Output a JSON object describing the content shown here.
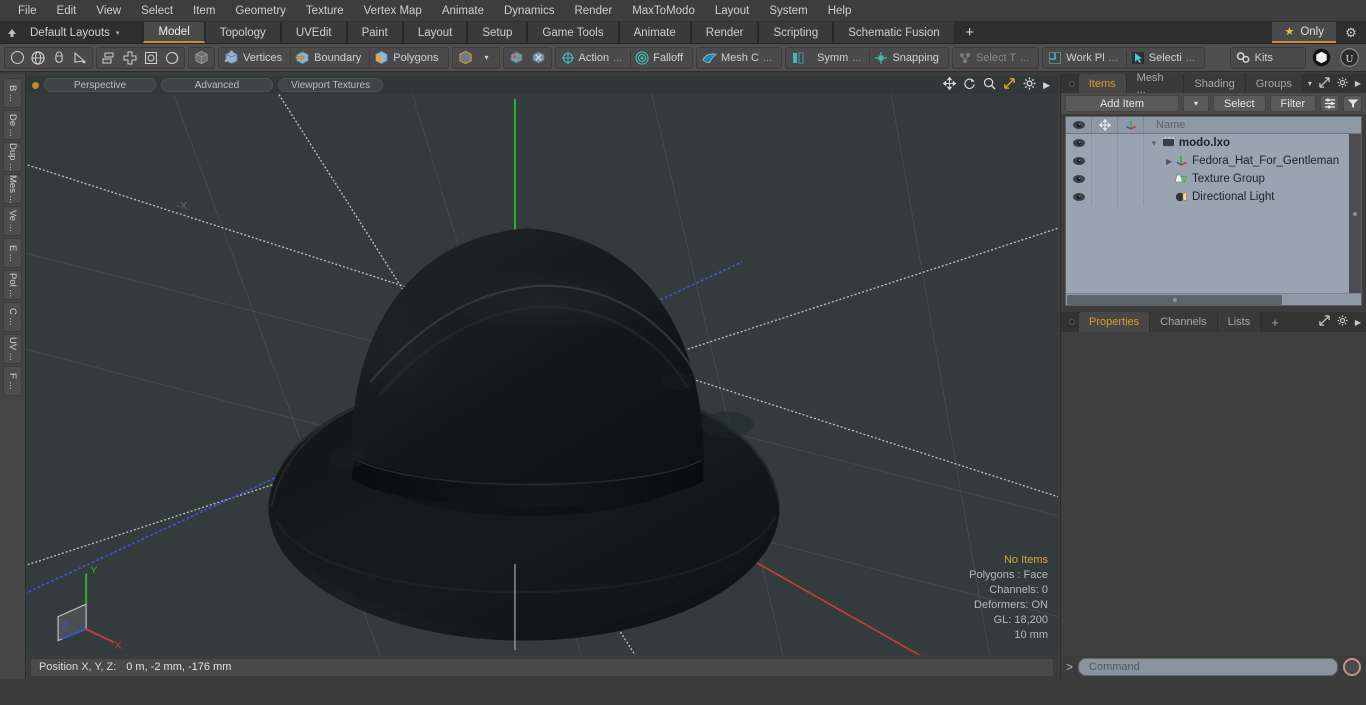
{
  "menu": {
    "items": [
      "File",
      "Edit",
      "View",
      "Select",
      "Item",
      "Geometry",
      "Texture",
      "Vertex Map",
      "Animate",
      "Dynamics",
      "Render",
      "MaxToModo",
      "Layout",
      "System",
      "Help"
    ]
  },
  "layoutbar": {
    "home_icon": "home-icon",
    "layouts_label": "Default Layouts",
    "caret": "▾",
    "tabs": [
      "Model",
      "Topology",
      "UVEdit",
      "Paint",
      "Layout",
      "Setup",
      "Game Tools",
      "Animate",
      "Render",
      "Scripting",
      "Schematic Fusion"
    ],
    "active_tab": "Model",
    "add_tab": "+",
    "only_label": "Only",
    "only_star": "★",
    "gear": "⚙"
  },
  "toolbar": {
    "group1": [
      {
        "name": "circle-tool-icon",
        "glyph": "◯"
      },
      {
        "name": "globe-tool-icon",
        "glyph": "⊕"
      },
      {
        "name": "cone-tool-icon",
        "glyph": "⬯"
      },
      {
        "name": "pen-tool-icon",
        "glyph": "◣"
      }
    ],
    "group2": [
      {
        "name": "align-tool-icon",
        "glyph": "▤"
      },
      {
        "name": "center-tool-icon",
        "glyph": "✛"
      },
      {
        "name": "bounds-tool-icon",
        "glyph": "▣"
      },
      {
        "name": "radial-tool-icon",
        "glyph": "◍"
      }
    ],
    "group3": [
      {
        "name": "items-mode-icon",
        "glyph": "▣",
        "label": ""
      }
    ],
    "selection_modes": [
      {
        "name": "vertices-mode",
        "label": "Vertices"
      },
      {
        "name": "boundary-mode",
        "label": "Boundary"
      },
      {
        "name": "polygons-mode",
        "label": "Polygons"
      }
    ],
    "mesh_dropdown": {
      "name": "mesh-item-dropdown",
      "glyph": "▾"
    },
    "snap_icons": [
      {
        "name": "center-pivot-icon"
      },
      {
        "name": "world-pivot-icon"
      }
    ],
    "action_center": {
      "label": "Action",
      "ellipsis": "..."
    },
    "falloff": {
      "label": "Falloff"
    },
    "mesh_constraint": {
      "label": "Mesh C",
      "ellipsis": "..."
    },
    "symmetry": {
      "label": "Symm",
      "ellipsis": "..."
    },
    "snapping": {
      "label": "Snapping"
    },
    "select_through": {
      "label": "Select T",
      "ellipsis": "...",
      "disabled": true
    },
    "work_plane": {
      "label": "Work Pl",
      "ellipsis": "..."
    },
    "selection_sets": {
      "label": "Selecti",
      "ellipsis": "..."
    },
    "kits": {
      "label": "Kits"
    },
    "app_icons": [
      {
        "name": "modo-logo-icon"
      },
      {
        "name": "unreal-logo-icon"
      }
    ]
  },
  "leftstrip": {
    "buttons": [
      "B ...",
      "De ...",
      "Dup ...",
      "Mes ...",
      "Ve ...",
      "E ...",
      "Pol ...",
      "C ...",
      "UV ...",
      "F ..."
    ]
  },
  "viewport": {
    "header": {
      "dot": "viewport-indicator",
      "chips": [
        "Perspective",
        "Advanced",
        "Viewport Textures"
      ],
      "tools": [
        {
          "name": "pan-icon",
          "glyph": "✥"
        },
        {
          "name": "rotate-icon",
          "glyph": "↻"
        },
        {
          "name": "zoom-icon",
          "glyph": "⌕"
        },
        {
          "name": "fit-icon",
          "glyph": "⤢"
        },
        {
          "name": "gear-icon",
          "glyph": "⚙"
        },
        {
          "name": "expand-arrow-icon",
          "glyph": "▶"
        }
      ]
    },
    "background_color": "#343b3d",
    "axis_labels": {
      "x": "X",
      "y": "Y",
      "z": "Z",
      "neg_x": "-X"
    },
    "axis_colors": {
      "x": "#c44040",
      "y": "#3fb23f",
      "z": "#4050c8",
      "grid": "#4a5254",
      "grid_major": "#c7cdce"
    },
    "model": {
      "name": "fedora-hat-model",
      "color": "#16191a"
    },
    "stats": [
      {
        "text": "No Items",
        "highlight": true
      },
      {
        "text": "Polygons : Face",
        "highlight": false
      },
      {
        "text": "Channels: 0",
        "highlight": false
      },
      {
        "text": "Deformers: ON",
        "highlight": false
      },
      {
        "text": "GL: 18,200",
        "highlight": false
      },
      {
        "text": "10 mm",
        "highlight": false
      }
    ]
  },
  "statusbar": {
    "label": "Position X, Y, Z:",
    "value": "0 m, -2 mm, -176 mm"
  },
  "rightpanel": {
    "toptabs": {
      "items": [
        "Items",
        "Mesh ...",
        "Shading",
        "Groups"
      ],
      "active": "Items",
      "overflow": "▾",
      "tools": [
        {
          "name": "popout-icon",
          "glyph": "⤢"
        },
        {
          "name": "gear-icon",
          "glyph": "⚙"
        },
        {
          "name": "expand-arrow-icon",
          "glyph": "▶"
        }
      ]
    },
    "actionbar": {
      "add_item": "Add Item",
      "add_item_caret": "▾",
      "select": "Select",
      "filter": "Filter",
      "list_icon": "list-options-icon",
      "funnel_icon": "funnel-icon"
    },
    "list": {
      "columns": [
        {
          "name": "visibility-column",
          "icon": "eye-icon"
        },
        {
          "name": "lock-column",
          "icon": "move-icon"
        },
        {
          "name": "transform-column",
          "icon": "axis-icon"
        },
        {
          "name": "name-column",
          "label": "Name"
        }
      ],
      "rows": [
        {
          "name": "modo.lxo",
          "icon": "scene-icon",
          "indent": 0,
          "bold": true,
          "expander": "▼",
          "eye": true
        },
        {
          "name": "Fedora_Hat_For_Gentleman",
          "icon": "mesh-axis-icon",
          "indent": 1,
          "bold": false,
          "expander": "▶",
          "eye": true
        },
        {
          "name": "Texture Group",
          "icon": "folder-icon",
          "indent": 2,
          "bold": false,
          "expander": "▪",
          "eye": true
        },
        {
          "name": "Directional Light",
          "icon": "light-icon",
          "indent": 2,
          "bold": false,
          "expander": "▪",
          "eye": true
        }
      ]
    },
    "bottomtabs": {
      "items": [
        "Properties",
        "Channels",
        "Lists"
      ],
      "active": "Properties",
      "add": "+",
      "tools": [
        {
          "name": "popout-icon",
          "glyph": "⤢"
        },
        {
          "name": "gear-icon",
          "glyph": "⚙"
        },
        {
          "name": "expand-arrow-icon",
          "glyph": "▶"
        }
      ]
    },
    "command": {
      "prompt": ">",
      "placeholder": "Command",
      "record_icon": "record-icon"
    }
  },
  "colors": {
    "accent": "#c88d35",
    "accent_text": "#e09b2d",
    "panel_bg": "#3c3c3c",
    "toolbar_bg": "#4f4f4f",
    "list_bg": "#9aa4b0",
    "viewport_bg": "#343b3d"
  }
}
